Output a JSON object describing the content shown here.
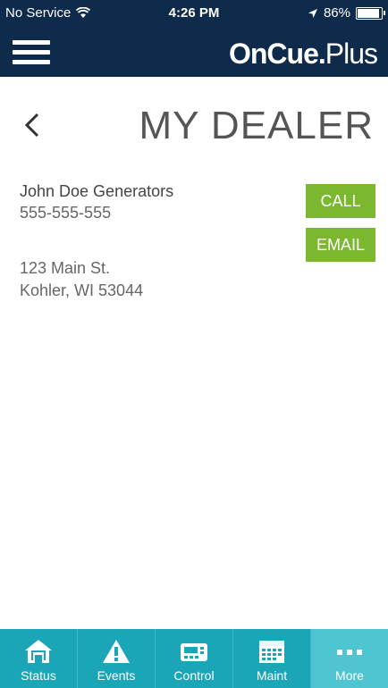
{
  "status_bar": {
    "carrier": "No Service",
    "time": "4:26 PM",
    "battery_percent": "86%",
    "battery_level": 0.86
  },
  "header": {
    "brand_bold": "OnCue",
    "brand_dot": ".",
    "brand_light": "Plus"
  },
  "page": {
    "title": "MY DEALER"
  },
  "dealer": {
    "name": "John Doe Generators",
    "phone": "555-555-555",
    "address_line1": "123 Main St.",
    "address_line2": "Kohler, WI 53044"
  },
  "actions": {
    "call_label": "CALL",
    "email_label": "EMAIL"
  },
  "tabs": [
    {
      "label": "Status",
      "icon": "home-icon"
    },
    {
      "label": "Events",
      "icon": "warning-icon"
    },
    {
      "label": "Control",
      "icon": "control-panel-icon"
    },
    {
      "label": "Maint",
      "icon": "calendar-icon"
    },
    {
      "label": "More",
      "icon": "more-icon",
      "active": true
    }
  ],
  "colors": {
    "header_bg": "#0f2b4c",
    "accent_green": "#7cb82f",
    "tab_bar": "#1aa6b7",
    "tab_active": "#4fc5d2"
  }
}
